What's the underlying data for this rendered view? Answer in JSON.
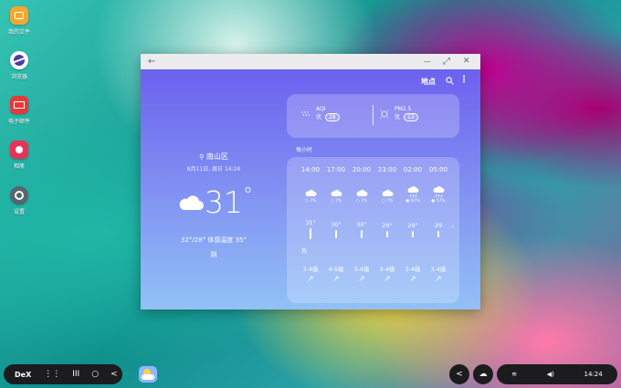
{
  "desktop": {
    "icons": [
      {
        "label": "我的文件",
        "color": "#f2a830"
      },
      {
        "label": "浏览器",
        "color": "#4a3aa8"
      },
      {
        "label": "电子邮件",
        "color": "#e8383a"
      },
      {
        "label": "相册",
        "color": "#e83358"
      },
      {
        "label": "设置",
        "color": "#566570"
      }
    ]
  },
  "window": {
    "back_glyph": "←",
    "minimize_glyph": "—",
    "restore_glyph": "⤢",
    "close_glyph": "✕"
  },
  "weather": {
    "header_title": "地点",
    "location": "南山区",
    "updated": "8月11日, 周日 14:24",
    "temperature": "31",
    "degree": "°",
    "range_feels": "32°/28° 体感温度 35°",
    "condition": "阴",
    "aqi": {
      "label": "AQI",
      "grade": "优",
      "value": "28"
    },
    "pm25": {
      "label": "PM2.5",
      "grade": "优",
      "value": "13"
    },
    "hourly_label": "每小时",
    "wind_label": "风",
    "hours": [
      {
        "time": "14:00",
        "pct": "○ 7%",
        "temp": "31°",
        "wind": "3-4级",
        "icon": "cloud",
        "level": 1.0
      },
      {
        "time": "17:00",
        "pct": "○ 7%",
        "temp": "30°",
        "wind": "4-5级",
        "icon": "cloud",
        "level": 0.8
      },
      {
        "time": "20:00",
        "pct": "○ 7%",
        "temp": "30°",
        "wind": "3-4级",
        "icon": "cloud",
        "level": 0.8
      },
      {
        "time": "23:00",
        "pct": "○ 7%",
        "temp": "29°",
        "wind": "3-4级",
        "icon": "cloud",
        "level": 0.6
      },
      {
        "time": "02:00",
        "pct": "● 61%",
        "temp": "29°",
        "wind": "3-4级",
        "icon": "rain",
        "level": 0.6
      },
      {
        "time": "05:00",
        "pct": "● 57%",
        "temp": "29",
        "wind": "3-4级",
        "icon": "rain",
        "level": 0.6
      }
    ]
  },
  "taskbar": {
    "dex_label": "DeX",
    "nav": [
      "⋮⋮",
      "III",
      "○",
      "<"
    ],
    "tray_back": "<",
    "tray_text": "14:24"
  }
}
